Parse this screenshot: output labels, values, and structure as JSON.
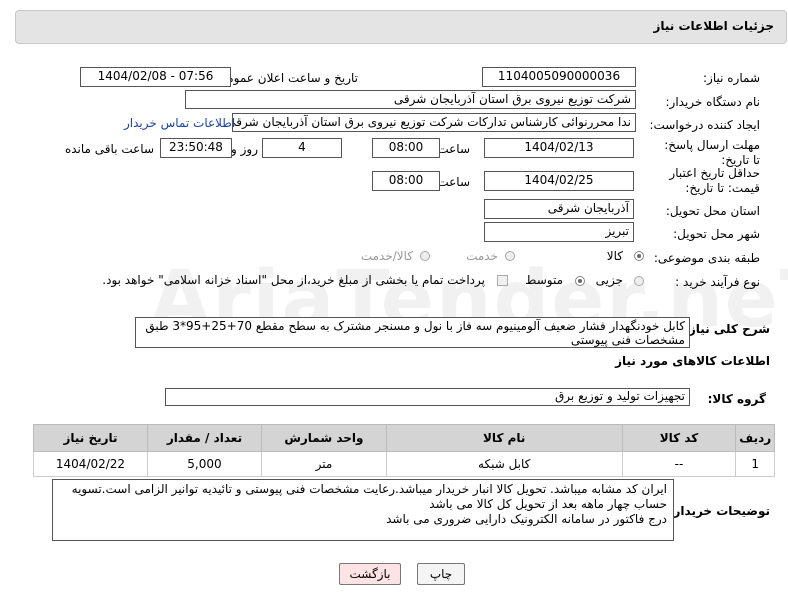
{
  "page": {
    "title": "جزئیات اطلاعات نیاز"
  },
  "labels": {
    "need_number": "شماره نیاز:",
    "announce_datetime": "تاریخ و ساعت اعلان عمومی:",
    "buyer_org": "نام دستگاه خریدار:",
    "requester": "ایجاد کننده درخواست:",
    "reply_deadline": "مهلت ارسال پاسخ: تا تاریخ:",
    "price_validity": "حداقل تاریخ اعتبار قیمت: تا تاریخ:",
    "time": "ساعت",
    "day_and": "روز و",
    "remaining": "ساعت باقی مانده",
    "delivery_province": "استان محل تحویل:",
    "delivery_city": "شهر محل تحویل:",
    "subject_category": "طبقه بندی موضوعی:",
    "purchase_type": "نوع فرآیند خرید :",
    "general_desc": "شرح کلی نیاز:",
    "goods_info": "اطلاعات کالاهای مورد نیاز",
    "goods_group": "گروه کالا:",
    "buyer_notes": "توضیحات خریدار:"
  },
  "fields": {
    "need_number": "1104005090000036",
    "announce_datetime": "1404/02/08 - 07:56",
    "buyer_org": "شرکت توزیع نیروی برق استان آذربایجان شرقی",
    "requester": "ندا محررنوائی کارشناس تدارکات شرکت توزیع نیروی برق استان آذربایجان شرقی",
    "buyer_contact_link": "اطلاعات تماس خریدار",
    "reply_date": "1404/02/13",
    "reply_time": "08:00",
    "reply_days": "4",
    "remaining_time": "23:50:48",
    "validity_date": "1404/02/25",
    "validity_time": "08:00",
    "delivery_province": "آذربایجان شرقی",
    "delivery_city": "تبریز",
    "general_desc": "کابل خودنگهدار فشار ضعیف آلومینیوم سه فاز با نول و مسنجر مشترک به سطح مقطع 70+25+95*3 طبق مشخصات فنی پیوستی",
    "goods_group": "تجهیزات تولید و توزیع برق",
    "buyer_notes_1": "ایران کد مشابه میباشد. تحویل کالا انبار خریدار میباشد.رعایت مشخصات فنی پیوستی و تائیدیه توانیر الزامی است.تسویه",
    "buyer_notes_2": "حساب چهار ماهه بعد از تحویل کل کالا می باشد",
    "buyer_notes_3": "درج فاکتور در سامانه الکترونیک دارایی ضروری می باشد"
  },
  "category_options": [
    {
      "label": "کالا",
      "selected": true
    },
    {
      "label": "خدمت",
      "selected": false
    },
    {
      "label": "کالا/خدمت",
      "selected": false
    }
  ],
  "purchase_options": [
    {
      "label": "جزیی",
      "selected": false
    },
    {
      "label": "متوسط",
      "selected": true
    }
  ],
  "payment_note": "پرداخت تمام یا بخشی از مبلغ خرید،از محل \"اسناد خزانه اسلامی\" خواهد بود.",
  "table": {
    "headers": [
      "ردیف",
      "کد کالا",
      "نام کالا",
      "واحد شمارش",
      "تعداد / مقدار",
      "تاریخ نیاز"
    ],
    "rows": [
      [
        "1",
        "--",
        "کابل شبکه",
        "متر",
        "5,000",
        "1404/02/22"
      ]
    ]
  },
  "buttons": {
    "print": "چاپ",
    "back": "بازگشت"
  },
  "watermark": "AriaTender.neT",
  "colors": {
    "header_bg": "#e4e4e4",
    "link": "#1a44a8",
    "back_button_bg": "#fde3e3"
  }
}
